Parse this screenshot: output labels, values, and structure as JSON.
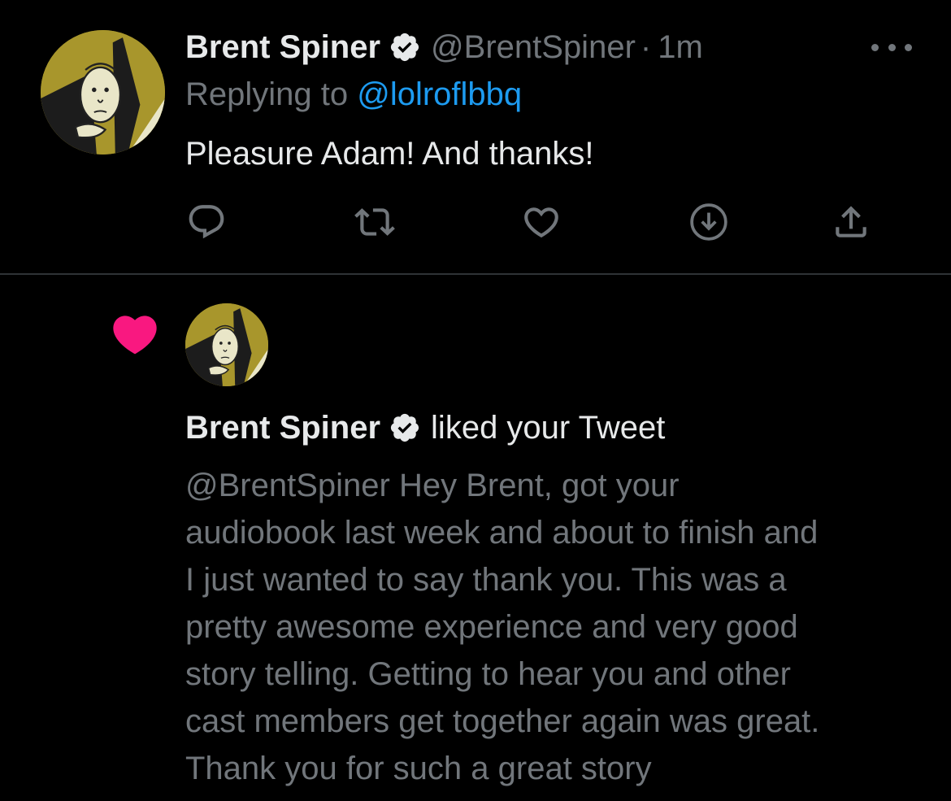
{
  "colors": {
    "background": "#000000",
    "primary_text": "#e7e9ea",
    "secondary_text": "#71767b",
    "link": "#1d9bf0",
    "divider": "#2f3336",
    "like_pink": "#f91880",
    "avatar_bg": "#a8962c"
  },
  "tweet": {
    "display_name": "Brent Spiner",
    "handle": "@BrentSpiner",
    "separator": "·",
    "time": "1m",
    "replying_prefix": "Replying to ",
    "replying_to": "@lolroflbbq",
    "text": "Pleasure Adam! And thanks!",
    "actions": [
      {
        "name": "reply",
        "icon": "reply-icon"
      },
      {
        "name": "retweet",
        "icon": "retweet-icon"
      },
      {
        "name": "like",
        "icon": "heart-outline-icon"
      },
      {
        "name": "download",
        "icon": "download-circle-icon"
      },
      {
        "name": "share",
        "icon": "share-icon"
      }
    ]
  },
  "notification": {
    "icon": "heart-filled-icon",
    "display_name": "Brent Spiner",
    "action_text": "liked your Tweet",
    "liked_tweet_text": "@BrentSpiner Hey Brent, got your\naudiobook last week and about to finish and\nI just wanted to say thank you. This was a\npretty awesome experience and very good\nstory telling. Getting to hear you and other\ncast members get together again was great.\nThank you for such a great story"
  }
}
